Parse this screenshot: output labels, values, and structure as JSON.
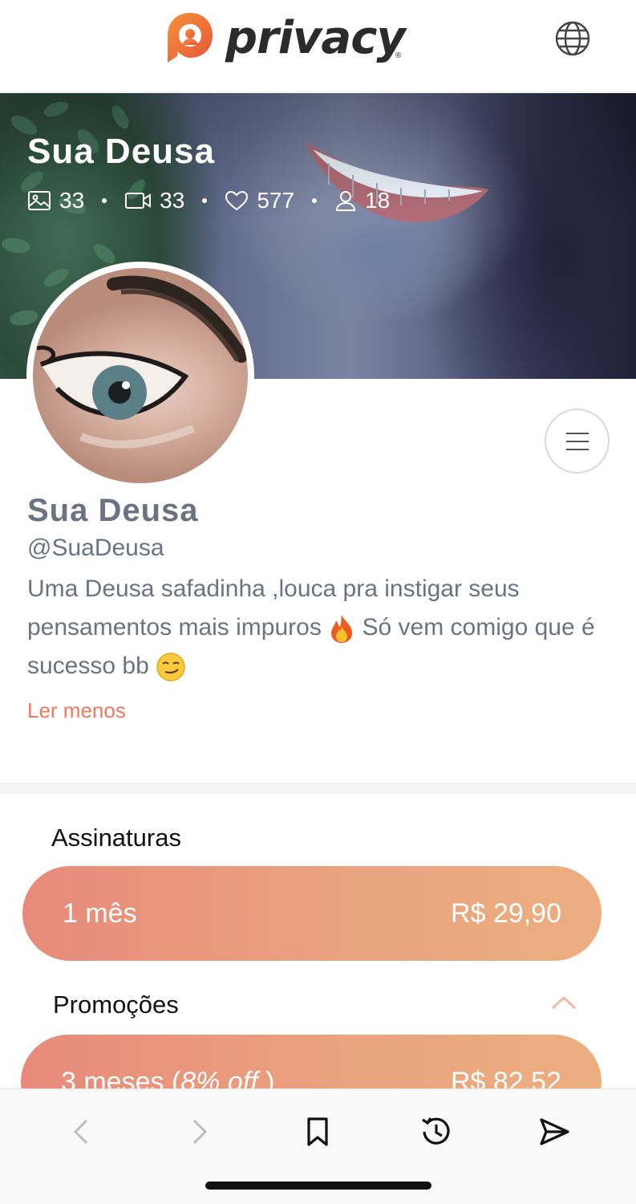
{
  "header": {
    "brand": "privacy",
    "registered_mark": "®",
    "logo_icon": "privacy-logo-icon",
    "language_icon": "globe-icon"
  },
  "cover": {
    "name": "Sua Deusa",
    "stats": {
      "photos": "33",
      "videos": "33",
      "likes": "577",
      "subscribers": "18"
    }
  },
  "profile": {
    "name": "Sua Deusa",
    "handle": "@SuaDeusa",
    "bio_part1": "Uma Deusa safadinha ,louca pra instigar seus pensamentos mais impuros",
    "bio_part2": "Só vem comigo que é sucesso bb",
    "toggle_label": "Ler menos",
    "menu_icon": "hamburger-menu-icon"
  },
  "subscriptions": {
    "title": "Assinaturas",
    "plans": [
      {
        "label": "1 mês",
        "price": "R$ 29,90"
      }
    ]
  },
  "promotions": {
    "title": "Promoções",
    "plans": [
      {
        "label": "3 meses (",
        "discount": "8% off",
        "label_end": " )",
        "price": "R$ 82,52"
      }
    ]
  },
  "colors": {
    "accent": "#ec7a5e",
    "plan_gradient_start": "#e88a7b",
    "plan_gradient_end": "#ecae80",
    "text_muted": "#6b7383"
  },
  "browser_bar": {
    "icons": [
      "back-icon",
      "forward-icon",
      "bookmark-icon",
      "history-icon",
      "share-icon"
    ]
  }
}
